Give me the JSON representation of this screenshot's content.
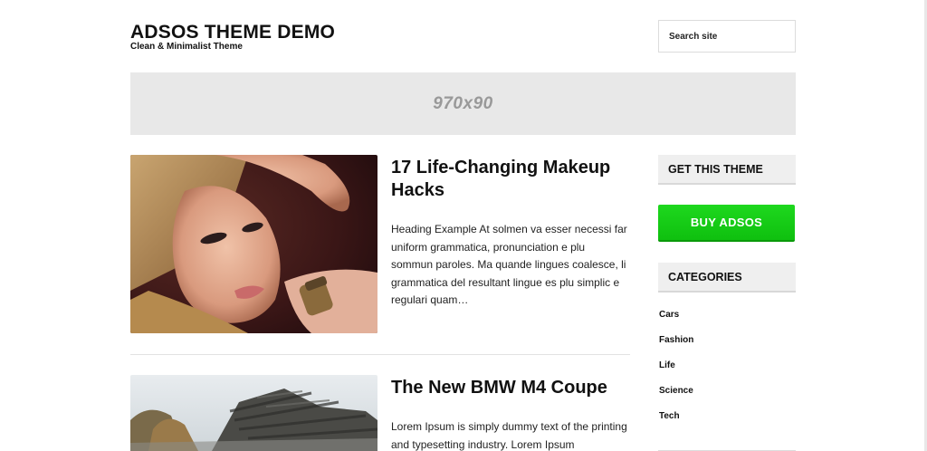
{
  "header": {
    "site_title": "ADSOS THEME DEMO",
    "tagline": "Clean & Minimalist Theme",
    "search_placeholder": "Search site"
  },
  "ad_banner": {
    "label": "970x90"
  },
  "posts": [
    {
      "title": "17 Life-Changing Makeup Hacks",
      "excerpt": "Heading Example At solmen va esser necessi far uniform grammatica, pronunciation e plu sommun paroles. Ma quande lingues coalesce, li grammatica del resultant lingue es plu simplic e regulari quam…",
      "thumbnail": "woman-portrait-image"
    },
    {
      "title": "The New BMW M4 Coupe",
      "excerpt": "Lorem Ipsum is simply dummy text of the printing and typesetting industry. Lorem Ipsum",
      "thumbnail": "car-motion-image"
    }
  ],
  "sidebar": {
    "get_theme_heading": "GET THIS THEME",
    "buy_button": "BUY ADSOS",
    "categories_heading": "CATEGORIES",
    "categories": [
      "Cars",
      "Fashion",
      "Life",
      "Science",
      "Tech"
    ]
  },
  "colors": {
    "buy_button": "#15cc15",
    "ad_banner_bg": "#e8e8e8",
    "widget_heading_bg": "#efefef"
  }
}
